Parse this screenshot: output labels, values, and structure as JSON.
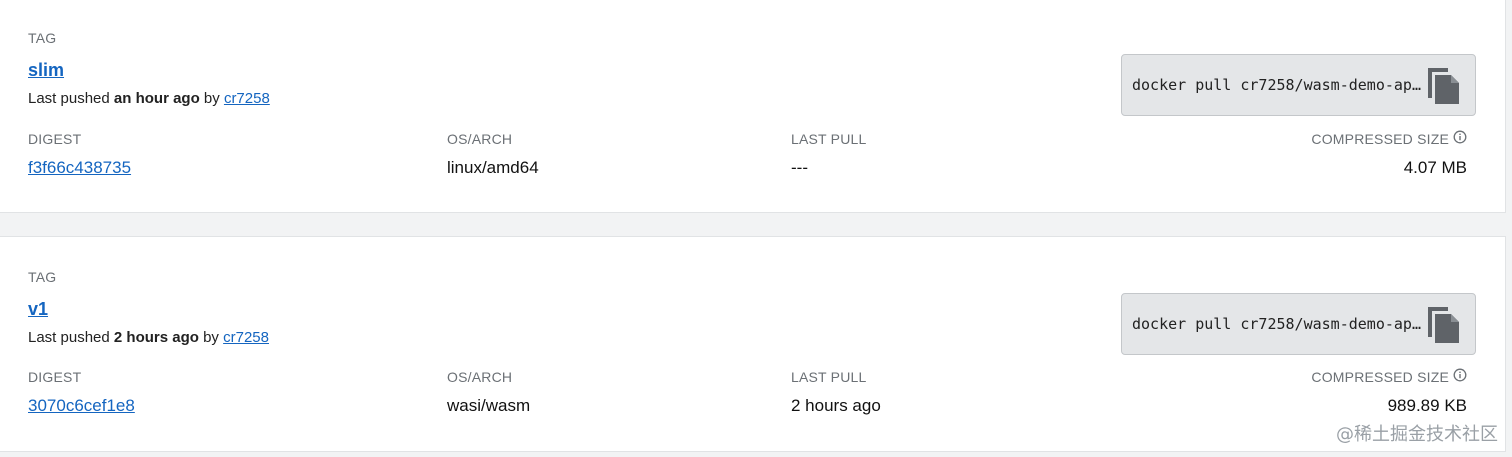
{
  "tags": [
    {
      "label_tag": "TAG",
      "name": "slim",
      "pushed_prefix": "Last pushed ",
      "pushed_time": "an hour ago",
      "pushed_by": " by ",
      "user": "cr7258",
      "command": "docker pull cr7258/wasm-demo-ap…",
      "labels": {
        "digest": "DIGEST",
        "os_arch": "OS/ARCH",
        "last_pull": "LAST PULL",
        "size": "COMPRESSED SIZE"
      },
      "digest": "f3f66c438735",
      "os_arch": "linux/amd64",
      "last_pull": "---",
      "size": "4.07 MB"
    },
    {
      "label_tag": "TAG",
      "name": "v1",
      "pushed_prefix": "Last pushed ",
      "pushed_time": "2 hours ago",
      "pushed_by": " by ",
      "user": "cr7258",
      "command": "docker pull cr7258/wasm-demo-ap…",
      "labels": {
        "digest": "DIGEST",
        "os_arch": "OS/ARCH",
        "last_pull": "LAST PULL",
        "size": "COMPRESSED SIZE"
      },
      "digest": "3070c6cef1e8",
      "os_arch": "wasi/wasm",
      "last_pull": "2 hours ago",
      "size": "989.89 KB"
    }
  ],
  "watermark": "@稀土掘金技术社区",
  "icons": {
    "copy": "copy-icon",
    "info": "info-icon"
  },
  "colors": {
    "link": "#1465c0",
    "card": "#ffffff",
    "background": "#f2f3f4"
  }
}
